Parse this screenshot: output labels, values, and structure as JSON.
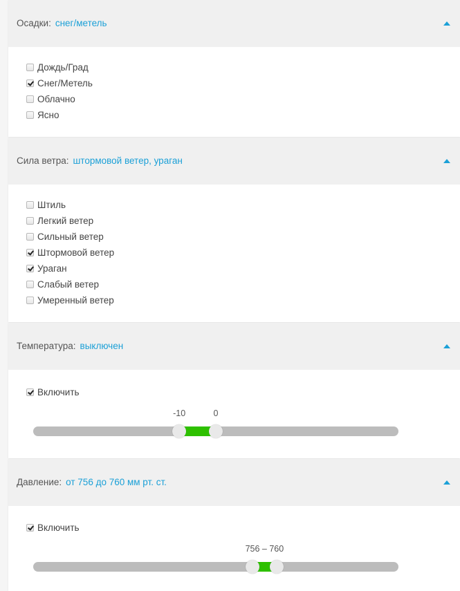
{
  "precipitation": {
    "label": "Осадки:",
    "value": "снег/метель",
    "options": [
      {
        "label": "Дождь/Град",
        "checked": false
      },
      {
        "label": "Снег/Метель",
        "checked": true
      },
      {
        "label": "Облачно",
        "checked": false
      },
      {
        "label": "Ясно",
        "checked": false
      }
    ]
  },
  "wind": {
    "label": "Сила ветра:",
    "value": "штормовой ветер, ураган",
    "options": [
      {
        "label": "Штиль",
        "checked": false
      },
      {
        "label": "Легкий ветер",
        "checked": false
      },
      {
        "label": "Сильный ветер",
        "checked": false
      },
      {
        "label": "Штормовой ветер",
        "checked": true
      },
      {
        "label": "Ураган",
        "checked": true
      },
      {
        "label": "Слабый ветер",
        "checked": false
      },
      {
        "label": "Умеренный ветер",
        "checked": false
      }
    ]
  },
  "temperature": {
    "label": "Температура:",
    "value": "выключен",
    "enable_label": "Включить",
    "enabled": true,
    "slider": {
      "min": -50,
      "max": 50,
      "low": -10,
      "high": 0,
      "low_label": "-10",
      "high_label": "0"
    }
  },
  "pressure": {
    "label": "Давление:",
    "value": "от 756 до 760 мм рт. ст.",
    "enable_label": "Включить",
    "enabled": true,
    "slider": {
      "min": 720,
      "max": 780,
      "low": 756,
      "high": 760,
      "range_label": "756 – 760"
    }
  },
  "colors": {
    "accent": "#1ba0d7",
    "range": "#2ec000",
    "track": "#bcbcbc"
  }
}
